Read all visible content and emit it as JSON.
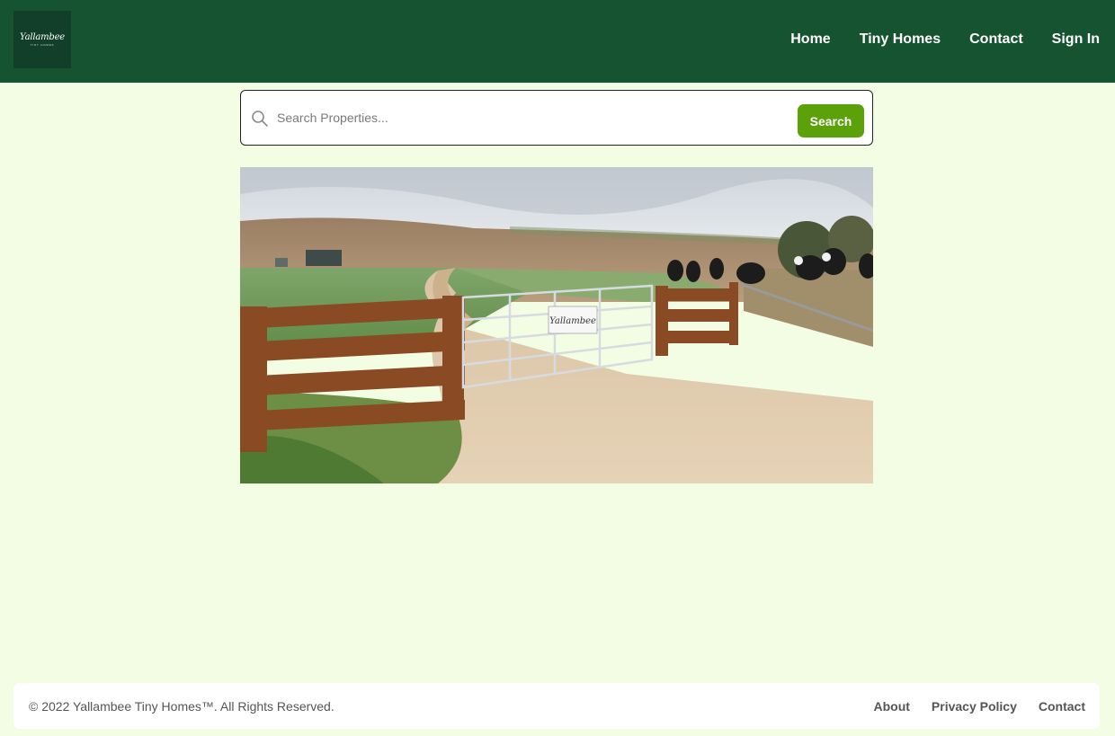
{
  "brand": {
    "logo_text": "Yallambee",
    "logo_subtext": "Tiny Homes"
  },
  "nav": {
    "items": [
      {
        "label": "Home"
      },
      {
        "label": "Tiny Homes"
      },
      {
        "label": "Contact"
      },
      {
        "label": "Sign In"
      }
    ]
  },
  "search": {
    "placeholder": "Search Properties...",
    "value": "",
    "button_label": "Search",
    "icon": "search-icon"
  },
  "hero": {
    "image_alt": "Farm gate with Yallambee sign and cattle in a paddock",
    "sign_text": "Yallambee"
  },
  "footer": {
    "copyright": "© 2022 Yallambee Tiny Homes™. All Rights Reserved.",
    "links": [
      {
        "label": "About"
      },
      {
        "label": "Privacy Policy"
      },
      {
        "label": "Contact"
      }
    ]
  },
  "colors": {
    "header_bg": "#155331",
    "page_bg": "#f3fde4",
    "accent": "#5aa10a"
  }
}
